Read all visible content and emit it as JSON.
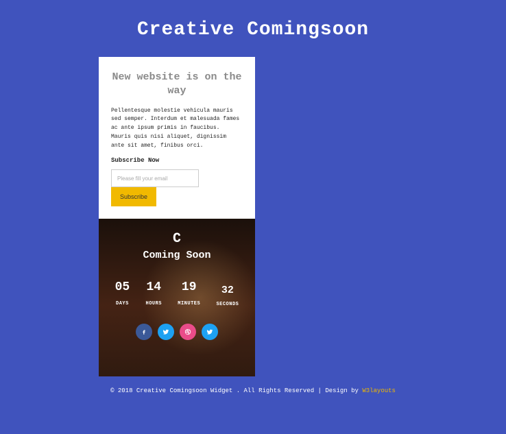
{
  "page": {
    "title": "Creative Comingsoon"
  },
  "upper": {
    "heading": "New website is on the way",
    "description": "Pellentesque molestie vehicula mauris sed semper. Interdum et malesuada fames ac ante ipsum primis in faucibus. Mauris quis nisi aliquet, dignissim ante sit amet, finibus orci.",
    "subscribe_label": "Subscribe Now",
    "email_placeholder": "Please fill your email",
    "subscribe_button": "Subscribe"
  },
  "lower": {
    "logo": "C",
    "title": "Coming Soon",
    "countdown": {
      "days": {
        "value": "05",
        "label": "DAYS"
      },
      "hours": {
        "value": "14",
        "label": "HOURS"
      },
      "minutes": {
        "value": "19",
        "label": "MINUTES"
      },
      "seconds": {
        "value": "32",
        "label": "SECONDS"
      }
    },
    "socials": {
      "facebook": "f",
      "twitter": "t",
      "dribbble": "d",
      "twitter2": "t"
    }
  },
  "footer": {
    "text": "© 2018 Creative Comingsoon Widget . All Rights Reserved | Design by ",
    "link": "W3layouts"
  }
}
